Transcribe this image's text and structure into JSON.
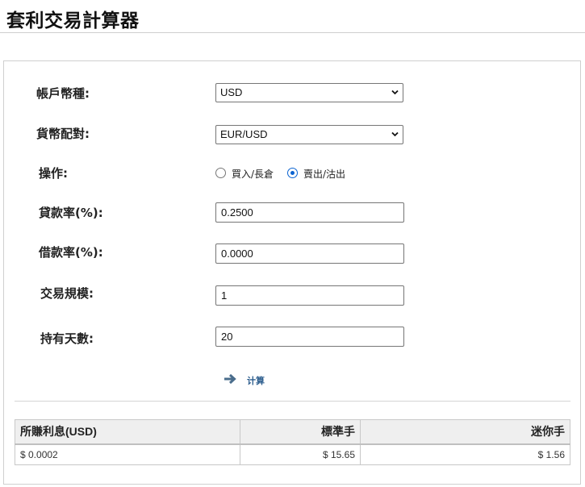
{
  "header": {
    "title": "套利交易計算器"
  },
  "form": {
    "account_currency": {
      "label": "帳戶幣種:",
      "value": "USD"
    },
    "currency_pair": {
      "label": "貨幣配對:",
      "value": "EUR/USD"
    },
    "operation": {
      "label": "操作:",
      "options": [
        {
          "label": "買入/長倉",
          "selected": false
        },
        {
          "label": "賣出/沽出",
          "selected": true
        }
      ]
    },
    "lending_rate": {
      "label": "貸款率(%):",
      "value": "0.2500"
    },
    "borrowing_rate": {
      "label": "借款率(%):",
      "value": "0.0000"
    },
    "trade_size": {
      "label": "交易規模:",
      "value": "1"
    },
    "holding_days": {
      "label": "持有天數:",
      "value": "20"
    },
    "calculate_label": "计算"
  },
  "results": {
    "headers": [
      "所賺利息(USD)",
      "標準手",
      "迷你手"
    ],
    "row": [
      "$ 0.0002",
      "$ 15.65",
      "$ 1.56"
    ]
  },
  "colors": {
    "accent": "#0b63d1",
    "button_text": "#2d5e8e",
    "header_bg": "#efefef"
  }
}
